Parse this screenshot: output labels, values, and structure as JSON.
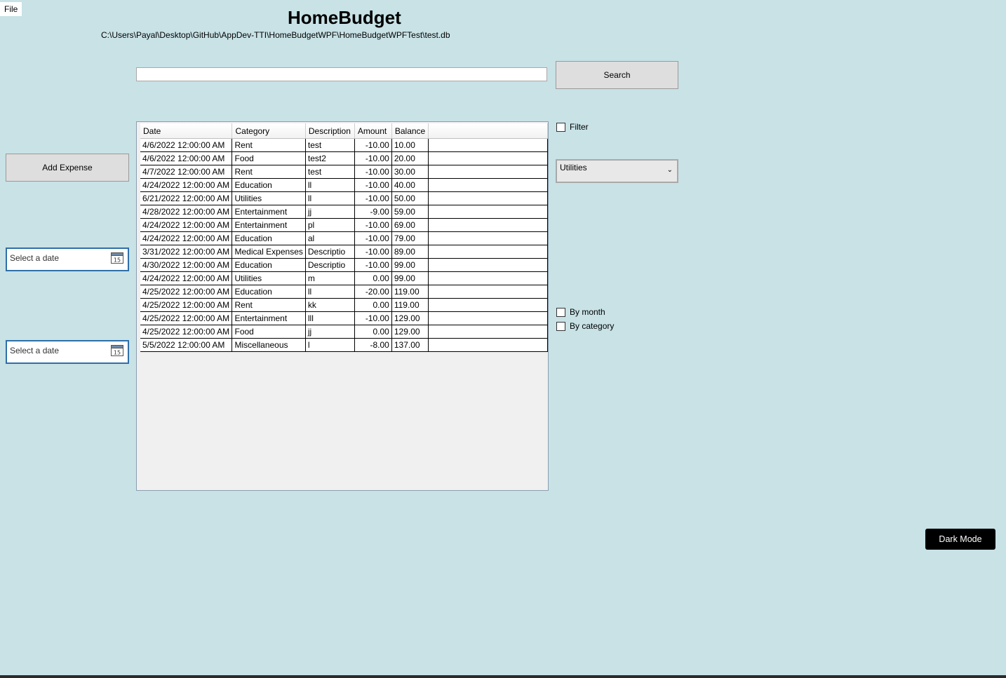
{
  "menu": {
    "file": "File"
  },
  "app": {
    "title": "HomeBudget",
    "db_path": "C:\\Users\\Payal\\Desktop\\GitHub\\AppDev-TTI\\HomeBudgetWPF\\HomeBudgetWPFTest\\test.db"
  },
  "search": {
    "value": "",
    "button_label": "Search"
  },
  "actions": {
    "add_expense": "Add Expense",
    "dark_mode": "Dark Mode"
  },
  "date_pickers": [
    {
      "placeholder": "Select a date",
      "icon": "calendar-icon",
      "icon_text": "15"
    },
    {
      "placeholder": "Select a date",
      "icon": "calendar-icon",
      "icon_text": "15"
    }
  ],
  "filter": {
    "label": "Filter",
    "category_selected": "Utilities",
    "by_month": "By month",
    "by_category": "By category"
  },
  "grid": {
    "columns": [
      "Date",
      "Category",
      "Description",
      "Amount",
      "Balance"
    ],
    "rows": [
      [
        "4/6/2022 12:00:00 AM",
        "Rent",
        "test",
        "-10.00",
        "10.00"
      ],
      [
        "4/6/2022 12:00:00 AM",
        "Food",
        "test2",
        "-10.00",
        "20.00"
      ],
      [
        "4/7/2022 12:00:00 AM",
        "Rent",
        "test",
        "-10.00",
        "30.00"
      ],
      [
        "4/24/2022 12:00:00 AM",
        "Education",
        "ll",
        "-10.00",
        "40.00"
      ],
      [
        "6/21/2022 12:00:00 AM",
        "Utilities",
        "ll",
        "-10.00",
        "50.00"
      ],
      [
        "4/28/2022 12:00:00 AM",
        "Entertainment",
        "jj",
        "-9.00",
        "59.00"
      ],
      [
        "4/24/2022 12:00:00 AM",
        "Entertainment",
        "pl",
        "-10.00",
        "69.00"
      ],
      [
        "4/24/2022 12:00:00 AM",
        "Education",
        "al",
        "-10.00",
        "79.00"
      ],
      [
        "3/31/2022 12:00:00 AM",
        "Medical Expenses",
        "Descriptio",
        "-10.00",
        "89.00"
      ],
      [
        "4/30/2022 12:00:00 AM",
        "Education",
        "Descriptio",
        "-10.00",
        "99.00"
      ],
      [
        "4/24/2022 12:00:00 AM",
        "Utilities",
        "m",
        "0.00",
        "99.00"
      ],
      [
        "4/25/2022 12:00:00 AM",
        "Education",
        "ll",
        "-20.00",
        "119.00"
      ],
      [
        "4/25/2022 12:00:00 AM",
        "Rent",
        "kk",
        "0.00",
        "119.00"
      ],
      [
        "4/25/2022 12:00:00 AM",
        "Entertainment",
        "lll",
        "-10.00",
        "129.00"
      ],
      [
        "4/25/2022 12:00:00 AM",
        "Food",
        "jj",
        "0.00",
        "129.00"
      ],
      [
        "5/5/2022 12:00:00 AM",
        "Miscellaneous",
        "l",
        "-8.00",
        "137.00"
      ]
    ]
  }
}
